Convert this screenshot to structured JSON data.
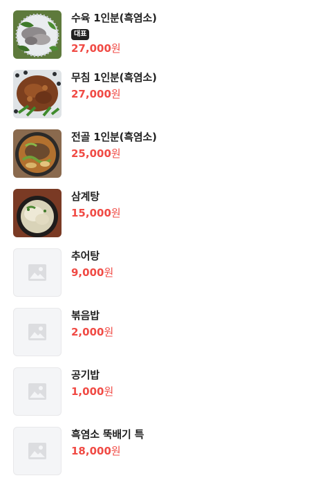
{
  "menu": {
    "currency": "원",
    "items": [
      {
        "name": "수육 1인분(흑염소)",
        "badge": "대표",
        "price": "27,000",
        "has_image": true
      },
      {
        "name": "무침 1인분(흑염소)",
        "price": "27,000",
        "has_image": true
      },
      {
        "name": "전골 1인분(흑염소)",
        "price": "25,000",
        "has_image": true
      },
      {
        "name": "삼계탕",
        "price": "15,000",
        "has_image": true
      },
      {
        "name": "추어탕",
        "price": "9,000",
        "has_image": false
      },
      {
        "name": "볶음밥",
        "price": "2,000",
        "has_image": false
      },
      {
        "name": "공기밥",
        "price": "1,000",
        "has_image": false
      },
      {
        "name": "흑염소 뚝배기 특",
        "price": "18,000",
        "has_image": false
      }
    ]
  },
  "colors": {
    "price": "#f04a44",
    "name": "#222222",
    "badge_bg": "#222222",
    "placeholder_bg": "#f4f5f7",
    "placeholder_icon": "#dcdde0"
  },
  "icons": {
    "placeholder": "image-placeholder-icon"
  }
}
